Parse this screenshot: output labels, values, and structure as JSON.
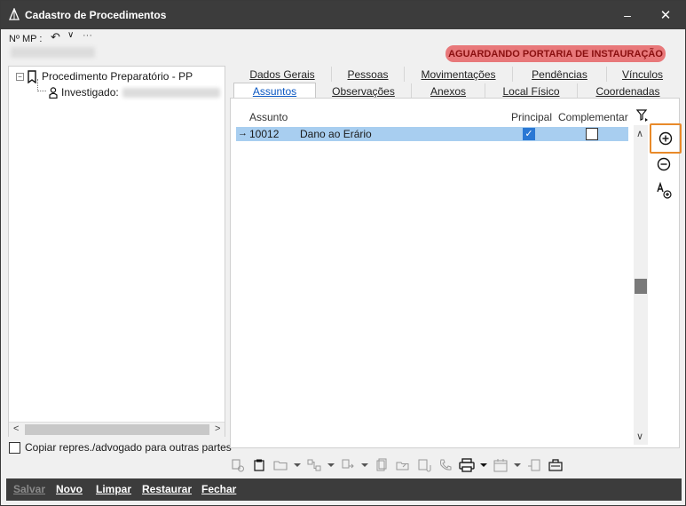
{
  "window": {
    "title": "Cadastro de Procedimentos",
    "minimize_glyph": "–",
    "close_glyph": "✕"
  },
  "header": {
    "mp_label": "Nº MP :",
    "undo_glyph": "↶",
    "dropdown_glyph": "∨",
    "more_glyph": "···",
    "status_badge": "AGUARDANDO PORTARIA DE INSTAURAÇÃO",
    "status_color": "#e8787a"
  },
  "tree": {
    "root_label": "Procedimento Preparatório - PP",
    "child_label": "Investigado:",
    "expander_glyph": "−"
  },
  "copy_option": {
    "label": "Copiar repres./advogado para outras partes",
    "checked": false
  },
  "tabs_row1": [
    "Dados Gerais",
    "Pessoas",
    "Movimentações",
    "Pendências",
    "Vínculos"
  ],
  "tabs_row2": [
    "Assuntos",
    "Observações",
    "Anexos",
    "Local Físico",
    "Coordenadas"
  ],
  "active_tab": "Assuntos",
  "grid": {
    "columns": {
      "assunto": "Assunto",
      "principal": "Principal",
      "complementar": "Complementar"
    },
    "rows": [
      {
        "indicator": "→",
        "code": "10012",
        "description": "Dano ao Erário",
        "principal": true,
        "complementar": false
      }
    ],
    "check_glyph": "✓",
    "scroll_up": "∧",
    "scroll_down": "∨"
  },
  "side_actions": [
    "add-icon",
    "remove-icon",
    "add-text-icon"
  ],
  "scroll": {
    "left": "<",
    "right": ">"
  },
  "toolbar_icons": [
    "copy-icon",
    "paste-icon",
    "folder-icon",
    "dropdown",
    "link-icon",
    "dropdown",
    "transfer-icon",
    "dropdown",
    "document-icon",
    "folder-share-icon",
    "attach-icon",
    "phone-icon",
    "print-icon",
    "dropdown",
    "calendar-icon",
    "dropdown",
    "report-icon",
    "case-icon"
  ],
  "footer": {
    "save": "Salvar",
    "new": "Novo",
    "clear": "Limpar",
    "restore": "Restaurar",
    "close": "Fechar"
  }
}
